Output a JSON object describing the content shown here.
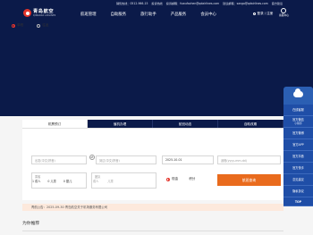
{
  "topbar": {
    "phone": "销售热线：0512-966-15",
    "complaint": "投诉热线",
    "email": "投诉邮箱：fuwufachen@qdairlines.com",
    "feedback": "建议邮箱：sango@qdairlines.com",
    "suggestion": "官方建议"
  },
  "logo": {
    "cn": "青岛航空",
    "en": "QINGDAO AIRLINES"
  },
  "nav": [
    "航班管理",
    "自助服务",
    "旅行助手",
    "产品服务",
    "会员中心"
  ],
  "login": "登录 / 注册",
  "service": {
    "label": "客服中心"
  },
  "tabs": [
    "机票预订",
    "值机办理",
    "航班动态",
    "自助改期"
  ],
  "radios": [
    {
      "label": "单程",
      "checked": true
    },
    {
      "label": "往返",
      "checked": false
    }
  ],
  "fields": {
    "from": {
      "placeholder": "出发(中文/拼音)"
    },
    "to": {
      "placeholder": "到达(中文/拼音)"
    },
    "date": {
      "value": "2025-10-01"
    },
    "return": {
      "placeholder": "返程(yyyy-mm-dd)"
    },
    "swap": "⇄"
  },
  "pax": {
    "label": "乘客",
    "adult": "1 成人",
    "child": "0 儿童",
    "infant": "0 婴儿",
    "group_label": "团队",
    "group1": "成人",
    "group2": "儿童"
  },
  "cabin": [
    {
      "label": "现金",
      "checked": true
    },
    {
      "label": "积分",
      "checked": false
    }
  ],
  "query_button": "航班查询",
  "notice": "青航公告：2025-09-30 青岛航空关于机场服务有限公司",
  "recommend": "为你推荐",
  "sidebar": [
    {
      "label": "在线客服",
      "sub": ""
    },
    {
      "label": "官方微信",
      "sub": "小程序"
    },
    {
      "label": "官方微博",
      "sub": ""
    },
    {
      "label": "官方APP",
      "sub": ""
    },
    {
      "label": "官方抖音",
      "sub": ""
    },
    {
      "label": "官方快手",
      "sub": ""
    },
    {
      "label": "意见建议",
      "sub": ""
    },
    {
      "label": "隐私协议",
      "sub": ""
    }
  ],
  "top_button": "TOP",
  "colors": {
    "brand_navy": "#0b1a49",
    "accent_orange": "#e96b1d",
    "sidebar_blue": "#1f4ea7",
    "logo_red": "#e4352b"
  }
}
